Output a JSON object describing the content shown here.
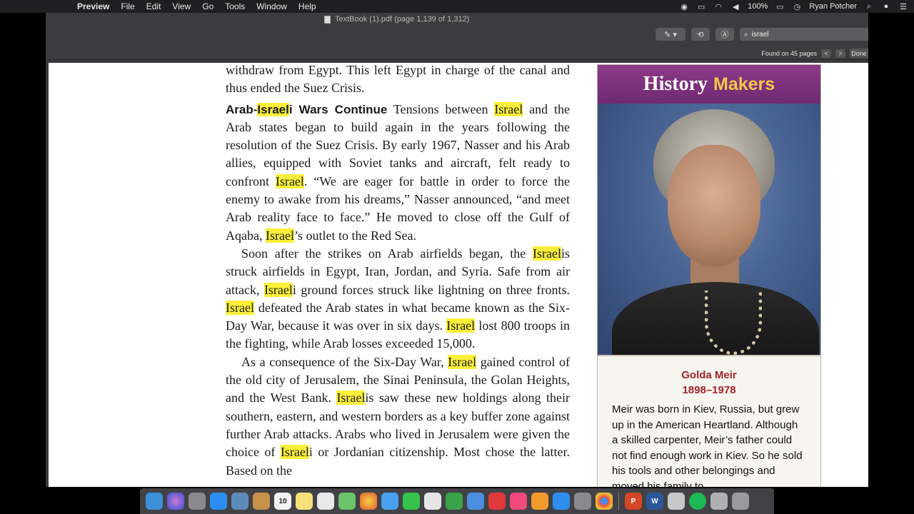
{
  "menubar": {
    "app_name": "Preview",
    "menus": [
      "File",
      "Edit",
      "View",
      "Go",
      "Tools",
      "Window",
      "Help"
    ],
    "battery": "100%",
    "user": "Ryan Potcher"
  },
  "window": {
    "title": "TextBook (1).pdf (page 1,139 of 1,312)",
    "search_value": "israel",
    "found_text": "Found on 45 pages",
    "prev_label": "<",
    "next_label": ">",
    "done_label": "Done"
  },
  "document": {
    "p0": "withdraw from Egypt. This left Egypt in charge of the canal and thus ended the Suez Crisis.",
    "p1": {
      "head_pre": "Arab-",
      "head_hl": "Israel",
      "head_post": "i Wars Continue",
      "t1": " Tensions between ",
      "hl1": "Israel",
      "t2": " and the Arab states began to build again in the years following the resolution of the Suez Crisis. By early 1967, Nasser and his Arab allies, equipped with Soviet tanks and aircraft, felt ready to confront ",
      "hl2": "Israel",
      "t3": ". “We are eager for battle in order to force the enemy to awake from his dreams,” Nasser announced, “and meet Arab reality face to face.” He moved to close off the Gulf of Aqaba, ",
      "hl3": "Israel",
      "t4": "’s outlet to the Red Sea."
    },
    "p2": {
      "t1": "Soon after the strikes on Arab airfields began, the ",
      "hl1": "Israel",
      "t2": "is struck airfields in Egypt, Iran, Jordan, and Syria. Safe from air attack, ",
      "hl2": "Israel",
      "t3": "i ground forces struck like lightning on three fronts. ",
      "hl3": "Israel",
      "t4": " defeated the Arab states in what became known as the Six-Day War, because it was over in six days. ",
      "hl4": "Israel",
      "t5": " lost 800 troops in the fighting, while Arab losses exceeded 15,000."
    },
    "p3": {
      "t1": "As a consequence of the Six-Day War, ",
      "hl1": "Israel",
      "t2": " gained control of the old city of Jerusalem, the Sinai Peninsula, the Golan Heights, and the West Bank. ",
      "hl2": "Israel",
      "t3": "is saw these new holdings along their southern, eastern, and western borders as a key buffer zone against further Arab attacks. Arabs who lived in Jerusalem were given the choice of ",
      "hl3": "Israel",
      "t4": "i or Jordanian citizenship. Most chose the latter. Based on the"
    }
  },
  "sidebar": {
    "heading_word1": "History",
    "heading_word2": "Makers",
    "name": "Golda Meir",
    "years": "1898–1978",
    "bio": "Meir was born in Kiev, Russia, but grew up in the American Heartland. Although a skilled carpenter, Meir’s father could not find enough work in Kiev. So he sold his tools and other belongings and moved his family to"
  },
  "dock": {
    "calendar_day": "10",
    "powerpoint_letter": "P",
    "word_letter": "W"
  }
}
